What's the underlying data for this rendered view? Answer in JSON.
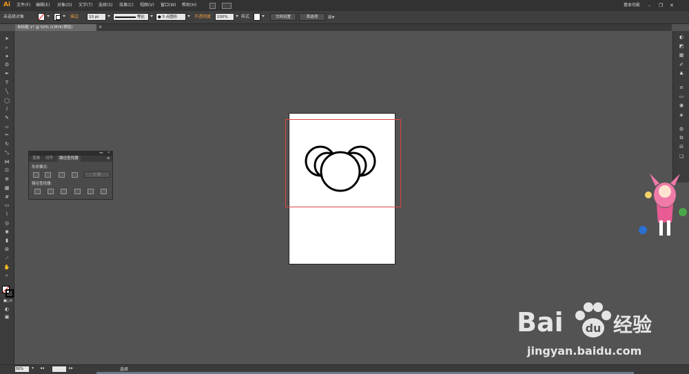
{
  "app": {
    "logo": "Ai",
    "menus": [
      "文件(F)",
      "编辑(E)",
      "对象(O)",
      "文字(T)",
      "选择(S)",
      "效果(C)",
      "视图(V)",
      "窗口(W)",
      "帮助(H)"
    ],
    "workspace": "基本功能"
  },
  "controlbar": {
    "selection_state": "未选择对象",
    "stroke_label": "描边",
    "stroke_weight": "10 pt",
    "stroke_profile": "等比",
    "brush": "5 点圆形",
    "opacity_label": "不透明度",
    "opacity_value": "100%",
    "style_label": "样式",
    "doc_setup_button": "文档设置",
    "preferences_button": "首选项"
  },
  "document": {
    "tab_title": "未标题-1* @ 50% (CMYK/预览)"
  },
  "pathfinder_panel": {
    "tabs": [
      "变换",
      "对齐",
      "路径查找器"
    ],
    "active_tab": 2,
    "shape_modes_label": "形状模式:",
    "pathfinders_label": "路径查找器:",
    "expand_button": "扩展"
  },
  "statusbar": {
    "zoom": "50%",
    "mode": "选择"
  },
  "watermark": {
    "brand": "Bai",
    "brand2": "经验",
    "url": "jingyan.baidu.com"
  }
}
